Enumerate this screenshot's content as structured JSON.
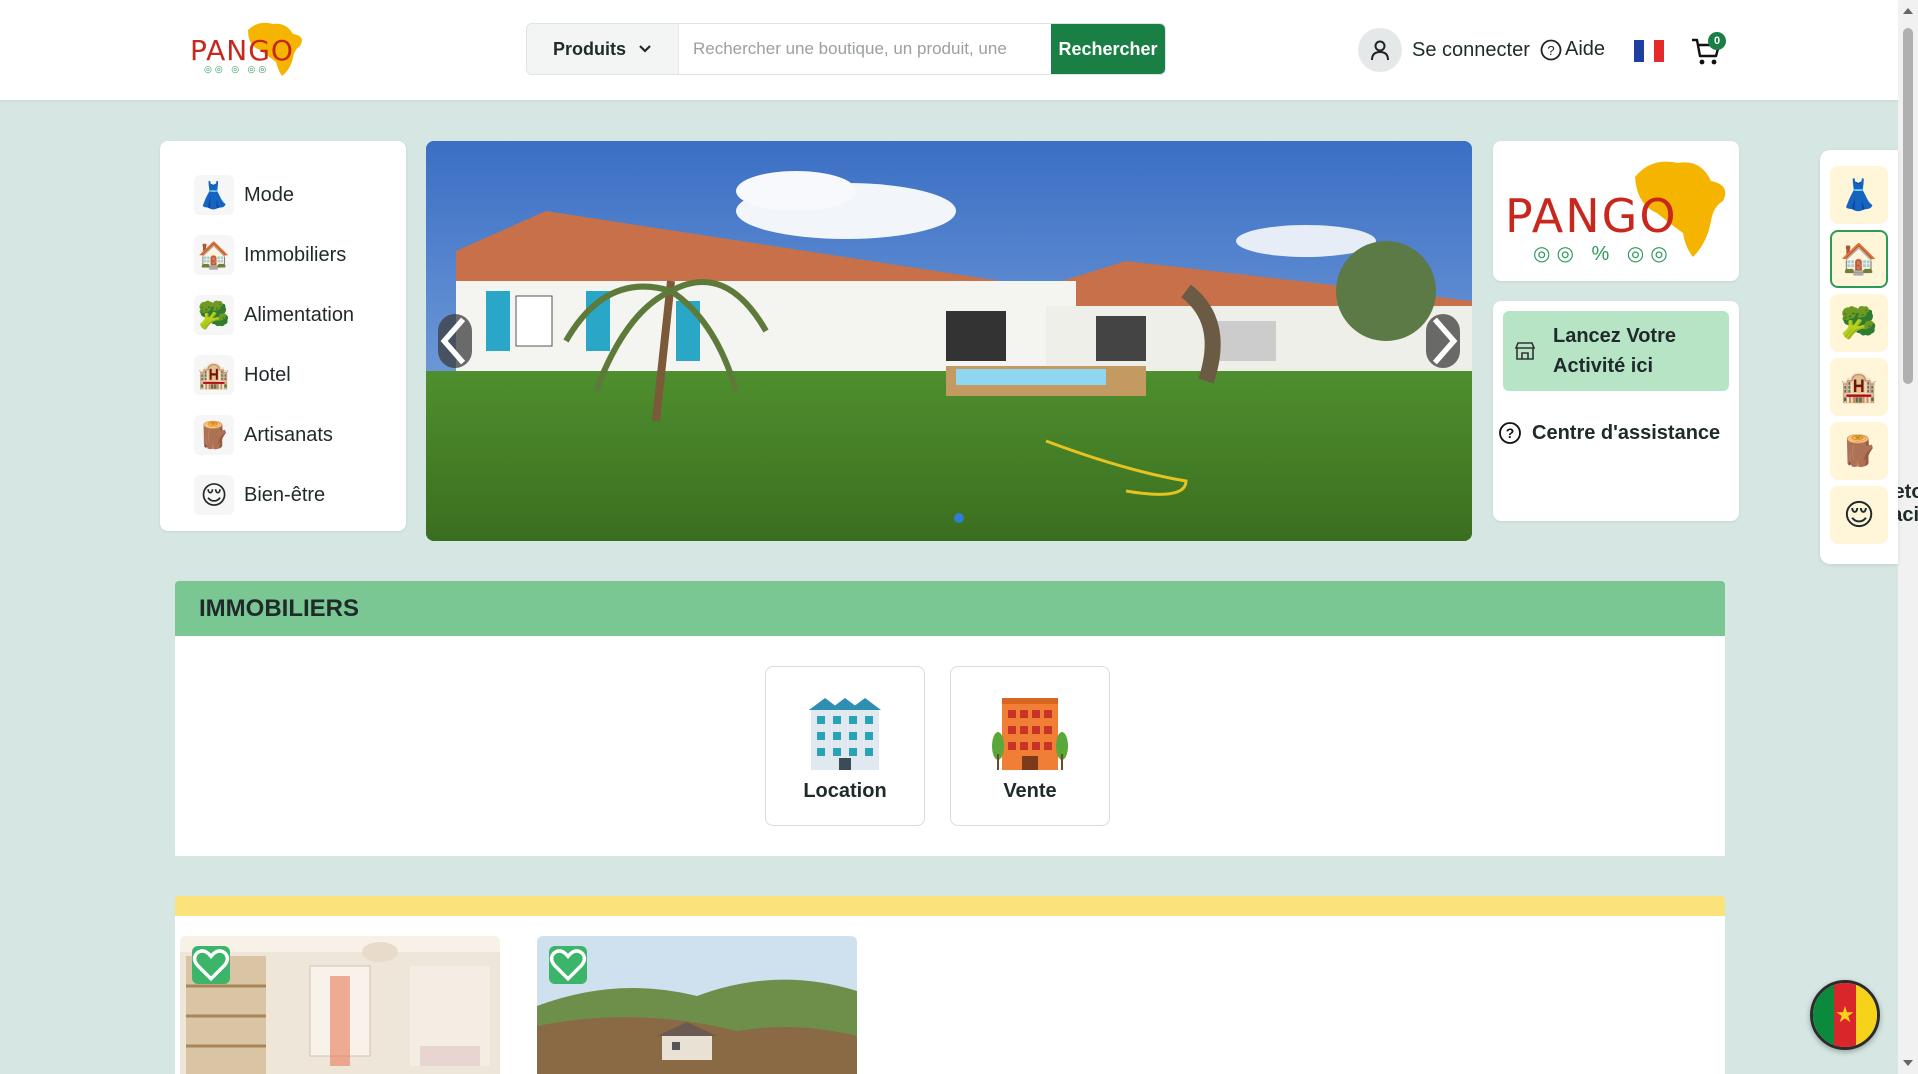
{
  "header": {
    "logo_text": "PANGO",
    "search": {
      "category_label": "Produits",
      "placeholder": "Rechercher une boutique, un produit, une",
      "button_label": "Rechercher"
    },
    "connect_label": "Se connecter",
    "help_label": "Aide",
    "cart_count": "0"
  },
  "categories": [
    {
      "label": "Mode",
      "icon": "fashion-icon"
    },
    {
      "label": "Immobiliers",
      "icon": "real-estate-icon"
    },
    {
      "label": "Alimentation",
      "icon": "food-icon"
    },
    {
      "label": "Hotel",
      "icon": "hotel-icon"
    },
    {
      "label": "Artisanats",
      "icon": "craft-icon"
    },
    {
      "label": "Bien-être",
      "icon": "wellness-icon"
    }
  ],
  "side_panel": {
    "logo_text": "PANGO",
    "launch_label": "Lancez Votre Activité ici",
    "links": [
      "Centre d'assistance",
      "Retour Facile"
    ]
  },
  "immobiliers": {
    "title": "IMMOBILIERS",
    "tiles": [
      "Location",
      "Vente"
    ]
  },
  "colors": {
    "brand_green": "#1a7f45",
    "section_green": "#7bc793",
    "accent_yellow": "#fbe27a",
    "logo_red": "#c8271d",
    "page_bg": "#d6e7e3"
  }
}
